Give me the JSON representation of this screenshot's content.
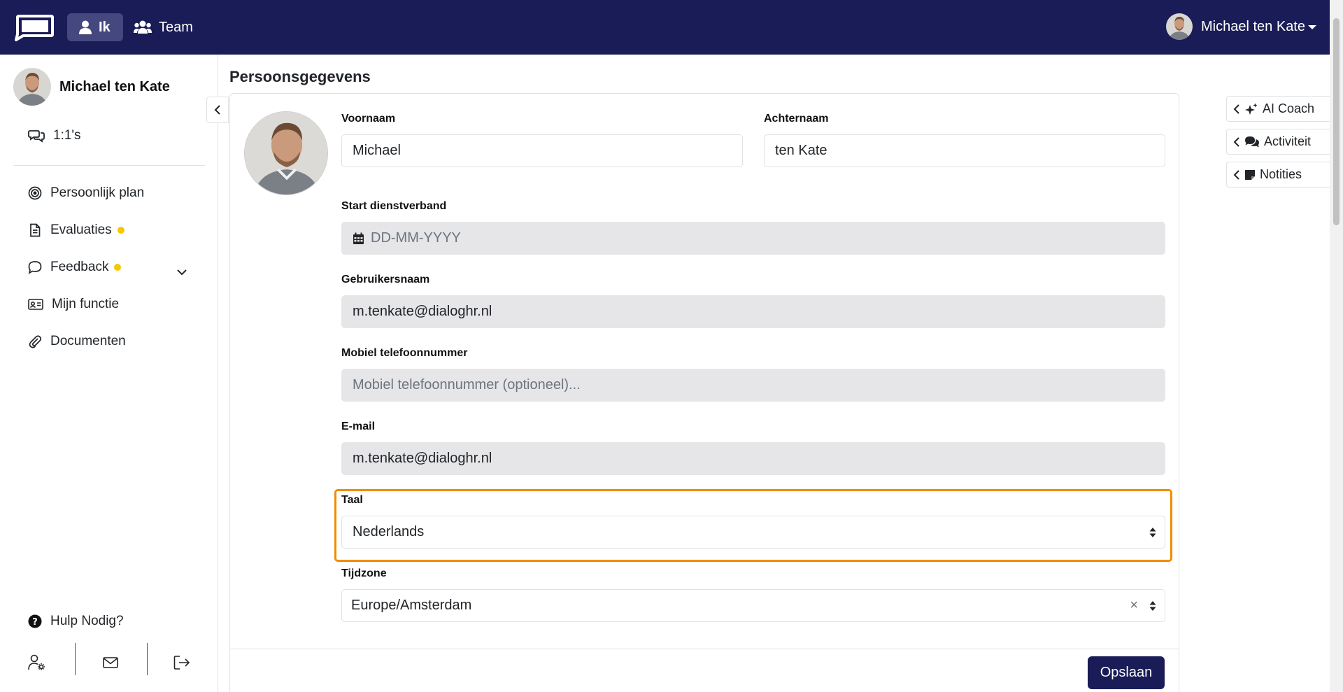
{
  "topbar": {
    "nav_ik": "Ik",
    "nav_team": "Team",
    "user_name": "Michael ten Kate"
  },
  "sidebar": {
    "profile_name": "Michael ten Kate",
    "one_on_ones": "1:1's",
    "items": [
      {
        "label": "Persoonlijk plan",
        "icon": "target-icon"
      },
      {
        "label": "Evaluaties",
        "icon": "document-icon",
        "dot": true
      },
      {
        "label": "Feedback",
        "icon": "speech-bubble-icon",
        "dot": true
      },
      {
        "label": "Mijn functie",
        "icon": "id-card-icon"
      },
      {
        "label": "Documenten",
        "icon": "paperclip-icon"
      }
    ],
    "help": "Hulp Nodig?"
  },
  "main": {
    "title": "Persoonsgegevens",
    "fields": {
      "voornaam_label": "Voornaam",
      "voornaam_value": "Michael",
      "achternaam_label": "Achternaam",
      "achternaam_value": "ten Kate",
      "start_label": "Start dienstverband",
      "start_placeholder": "DD-MM-YYYY",
      "username_label": "Gebruikersnaam",
      "username_value": "m.tenkate@dialoghr.nl",
      "phone_label": "Mobiel telefoonnummer",
      "phone_placeholder": "Mobiel telefoonnummer (optioneel)...",
      "email_label": "E-mail",
      "email_value": "m.tenkate@dialoghr.nl",
      "taal_label": "Taal",
      "taal_value": "Nederlands",
      "tijdzone_label": "Tijdzone",
      "tijdzone_value": "Europe/Amsterdam",
      "clear_symbol": "×"
    },
    "save_label": "Opslaan"
  },
  "right_panel": {
    "ai_coach": "AI Coach",
    "activiteit": "Activiteit",
    "notities": "Notities"
  },
  "colors": {
    "brand_navy": "#1a1c57",
    "active_tab": "#45487f",
    "notification_dot": "#f5c800",
    "highlight": "#f08c00"
  }
}
